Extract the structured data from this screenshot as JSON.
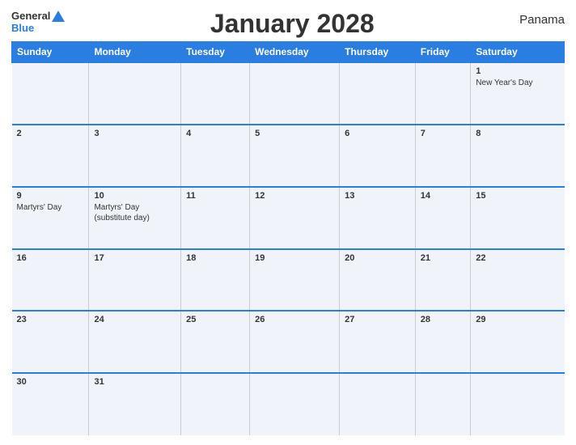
{
  "header": {
    "logo_general": "General",
    "logo_blue": "Blue",
    "title": "January 2028",
    "country": "Panama"
  },
  "days_of_week": [
    "Sunday",
    "Monday",
    "Tuesday",
    "Wednesday",
    "Thursday",
    "Friday",
    "Saturday"
  ],
  "weeks": [
    [
      {
        "day": "",
        "events": []
      },
      {
        "day": "",
        "events": []
      },
      {
        "day": "",
        "events": []
      },
      {
        "day": "",
        "events": []
      },
      {
        "day": "",
        "events": []
      },
      {
        "day": "",
        "events": []
      },
      {
        "day": "1",
        "events": [
          "New Year's Day"
        ]
      }
    ],
    [
      {
        "day": "2",
        "events": []
      },
      {
        "day": "3",
        "events": []
      },
      {
        "day": "4",
        "events": []
      },
      {
        "day": "5",
        "events": []
      },
      {
        "day": "6",
        "events": []
      },
      {
        "day": "7",
        "events": []
      },
      {
        "day": "8",
        "events": []
      }
    ],
    [
      {
        "day": "9",
        "events": [
          "Martyrs' Day"
        ]
      },
      {
        "day": "10",
        "events": [
          "Martyrs' Day",
          "(substitute day)"
        ]
      },
      {
        "day": "11",
        "events": []
      },
      {
        "day": "12",
        "events": []
      },
      {
        "day": "13",
        "events": []
      },
      {
        "day": "14",
        "events": []
      },
      {
        "day": "15",
        "events": []
      }
    ],
    [
      {
        "day": "16",
        "events": []
      },
      {
        "day": "17",
        "events": []
      },
      {
        "day": "18",
        "events": []
      },
      {
        "day": "19",
        "events": []
      },
      {
        "day": "20",
        "events": []
      },
      {
        "day": "21",
        "events": []
      },
      {
        "day": "22",
        "events": []
      }
    ],
    [
      {
        "day": "23",
        "events": []
      },
      {
        "day": "24",
        "events": []
      },
      {
        "day": "25",
        "events": []
      },
      {
        "day": "26",
        "events": []
      },
      {
        "day": "27",
        "events": []
      },
      {
        "day": "28",
        "events": []
      },
      {
        "day": "29",
        "events": []
      }
    ],
    [
      {
        "day": "30",
        "events": []
      },
      {
        "day": "31",
        "events": []
      },
      {
        "day": "",
        "events": []
      },
      {
        "day": "",
        "events": []
      },
      {
        "day": "",
        "events": []
      },
      {
        "day": "",
        "events": []
      },
      {
        "day": "",
        "events": []
      }
    ]
  ]
}
